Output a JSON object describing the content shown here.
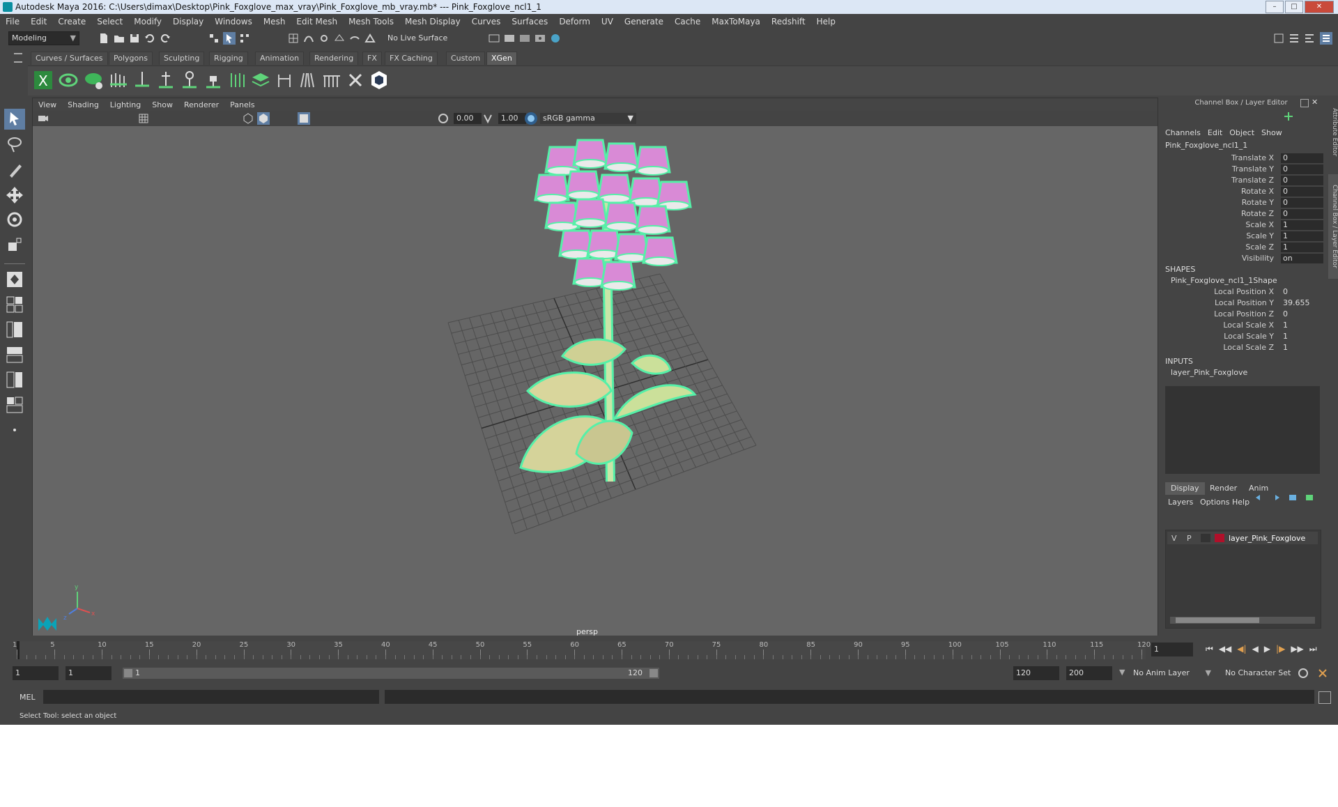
{
  "window": {
    "title": "Autodesk Maya 2016: C:\\Users\\dimax\\Desktop\\Pink_Foxglove_max_vray\\Pink_Foxglove_mb_vray.mb*  ---  Pink_Foxglove_ncl1_1"
  },
  "menubar": [
    "File",
    "Edit",
    "Create",
    "Select",
    "Modify",
    "Display",
    "Windows",
    "Mesh",
    "Edit Mesh",
    "Mesh Tools",
    "Mesh Display",
    "Curves",
    "Surfaces",
    "Deform",
    "UV",
    "Generate",
    "Cache",
    "MaxToMaya",
    "Redshift",
    "Help"
  ],
  "statusline": {
    "mode": "Modeling",
    "live_surface": "No Live Surface"
  },
  "shelf_tabs": [
    "Curves / Surfaces",
    "Polygons",
    "Sculpting",
    "Rigging",
    "Animation",
    "Rendering",
    "FX",
    "FX Caching",
    "Custom",
    "XGen"
  ],
  "active_shelf_tab": "XGen",
  "viewport": {
    "menu": [
      "View",
      "Shading",
      "Lighting",
      "Show",
      "Renderer",
      "Panels"
    ],
    "exposure": "0.00",
    "gamma": "1.00",
    "color_space": "sRGB gamma",
    "camera_label": "persp"
  },
  "channel_box": {
    "title": "Channel Box / Layer Editor",
    "menu": [
      "Channels",
      "Edit",
      "Object",
      "Show"
    ],
    "object_name": "Pink_Foxglove_ncl1_1",
    "attributes": [
      {
        "label": "Translate X",
        "value": "0"
      },
      {
        "label": "Translate Y",
        "value": "0"
      },
      {
        "label": "Translate Z",
        "value": "0"
      },
      {
        "label": "Rotate X",
        "value": "0"
      },
      {
        "label": "Rotate Y",
        "value": "0"
      },
      {
        "label": "Rotate Z",
        "value": "0"
      },
      {
        "label": "Scale X",
        "value": "1"
      },
      {
        "label": "Scale Y",
        "value": "1"
      },
      {
        "label": "Scale Z",
        "value": "1"
      },
      {
        "label": "Visibility",
        "value": "on"
      }
    ],
    "shapes_header": "SHAPES",
    "shape_name": "Pink_Foxglove_ncl1_1Shape",
    "shape_attributes": [
      {
        "label": "Local Position X",
        "value": "0"
      },
      {
        "label": "Local Position Y",
        "value": "39.655"
      },
      {
        "label": "Local Position Z",
        "value": "0"
      },
      {
        "label": "Local Scale X",
        "value": "1"
      },
      {
        "label": "Local Scale Y",
        "value": "1"
      },
      {
        "label": "Local Scale Z",
        "value": "1"
      }
    ],
    "inputs_header": "INPUTS",
    "input_name": "layer_Pink_Foxglove"
  },
  "layer_editor": {
    "tabs": [
      "Display",
      "Render",
      "Anim"
    ],
    "menu": [
      "Layers",
      "Options",
      "Help"
    ],
    "layer": {
      "v": "V",
      "p": "P",
      "name": "layer_Pink_Foxglove",
      "color": "#b0102a"
    }
  },
  "side_tabs": [
    "Attribute Editor",
    "Channel Box / Layer Editor"
  ],
  "timeline": {
    "ticks": [
      1,
      5,
      10,
      15,
      20,
      25,
      30,
      35,
      40,
      45,
      50,
      55,
      60,
      65,
      70,
      75,
      80,
      85,
      90,
      95,
      100,
      105,
      110,
      115,
      120
    ],
    "current_frame": "1"
  },
  "range": {
    "start": "1",
    "anim_start": "1",
    "range_start": "1",
    "range_end": "120",
    "anim_end": "120",
    "end": "200",
    "anim_layer": "No Anim Layer",
    "character_set": "No Character Set"
  },
  "command_line": {
    "label": "MEL"
  },
  "help_line": {
    "text": "Select Tool: select an object"
  },
  "colors": {
    "wire": "#55f0a8",
    "petal": "#d98ad6",
    "bg": "#444444",
    "viewport": "#666666"
  }
}
